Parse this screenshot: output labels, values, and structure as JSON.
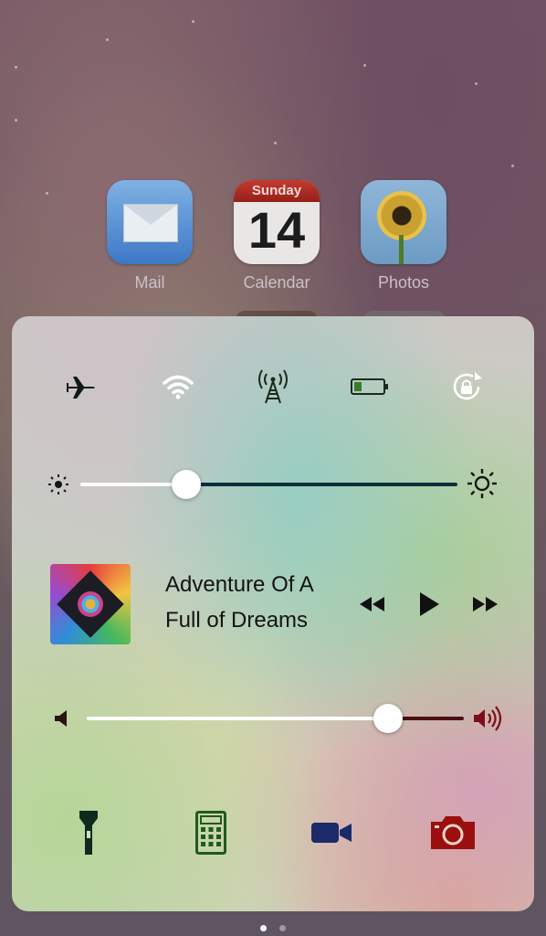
{
  "home": {
    "apps": [
      {
        "label": "Mail"
      },
      {
        "label": "Calendar",
        "day_name": "Sunday",
        "day_number": "14"
      },
      {
        "label": "Photos"
      }
    ]
  },
  "control_center": {
    "toggles": {
      "airplane": {
        "icon": "airplane-icon"
      },
      "wifi": {
        "icon": "wifi-icon"
      },
      "cellular": {
        "icon": "cellular-tower-icon"
      },
      "battery": {
        "icon": "battery-icon"
      },
      "rotation_lock": {
        "icon": "rotation-lock-icon"
      }
    },
    "brightness": {
      "level": 0.28
    },
    "now_playing": {
      "title_line_1": "Adventure Of A",
      "title_line_2": "Full of Dreams"
    },
    "volume": {
      "level": 0.8
    },
    "shortcuts": {
      "flashlight": {
        "icon": "flashlight-icon"
      },
      "calculator": {
        "icon": "calculator-icon"
      },
      "video": {
        "icon": "video-camera-icon"
      },
      "camera": {
        "icon": "camera-icon"
      }
    },
    "colors": {
      "brightness_track": "#0c2f3a",
      "volume_track": "#4a1212",
      "calculator": "#1f5a1f",
      "video": "#1d2a6a",
      "camera": "#9b0f0f"
    }
  },
  "page_indicator": {
    "total": 2,
    "current": 1
  }
}
